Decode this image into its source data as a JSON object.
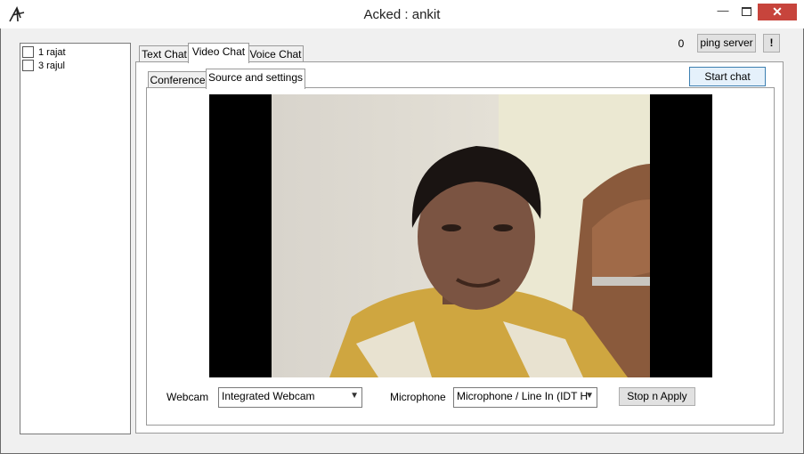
{
  "window": {
    "title": "Acked : ankit",
    "min_glyph": "—",
    "close_glyph": "✕"
  },
  "users": [
    {
      "label": "1 rajat",
      "checked": false
    },
    {
      "label": "3 rajul",
      "checked": false
    }
  ],
  "main_tabs": [
    {
      "label": "Text Chat",
      "active": false
    },
    {
      "label": "Video Chat",
      "active": true
    },
    {
      "label": "Voice Chat",
      "active": false
    }
  ],
  "sub_tabs": [
    {
      "label": "Conference",
      "active": false
    },
    {
      "label": "Source and settings",
      "active": true
    }
  ],
  "toolbar": {
    "ping_count": "0",
    "ping_label": "ping server",
    "alert_label": "!"
  },
  "video_panel": {
    "start_chat_label": "Start chat"
  },
  "settings": {
    "webcam_label": "Webcam",
    "webcam_value": "Integrated Webcam",
    "mic_label": "Microphone",
    "mic_value": "Microphone / Line In (IDT H",
    "apply_label": "Stop n Apply"
  },
  "colors": {
    "close_button": "#c7443c",
    "accent_border": "#3c7fb1"
  }
}
